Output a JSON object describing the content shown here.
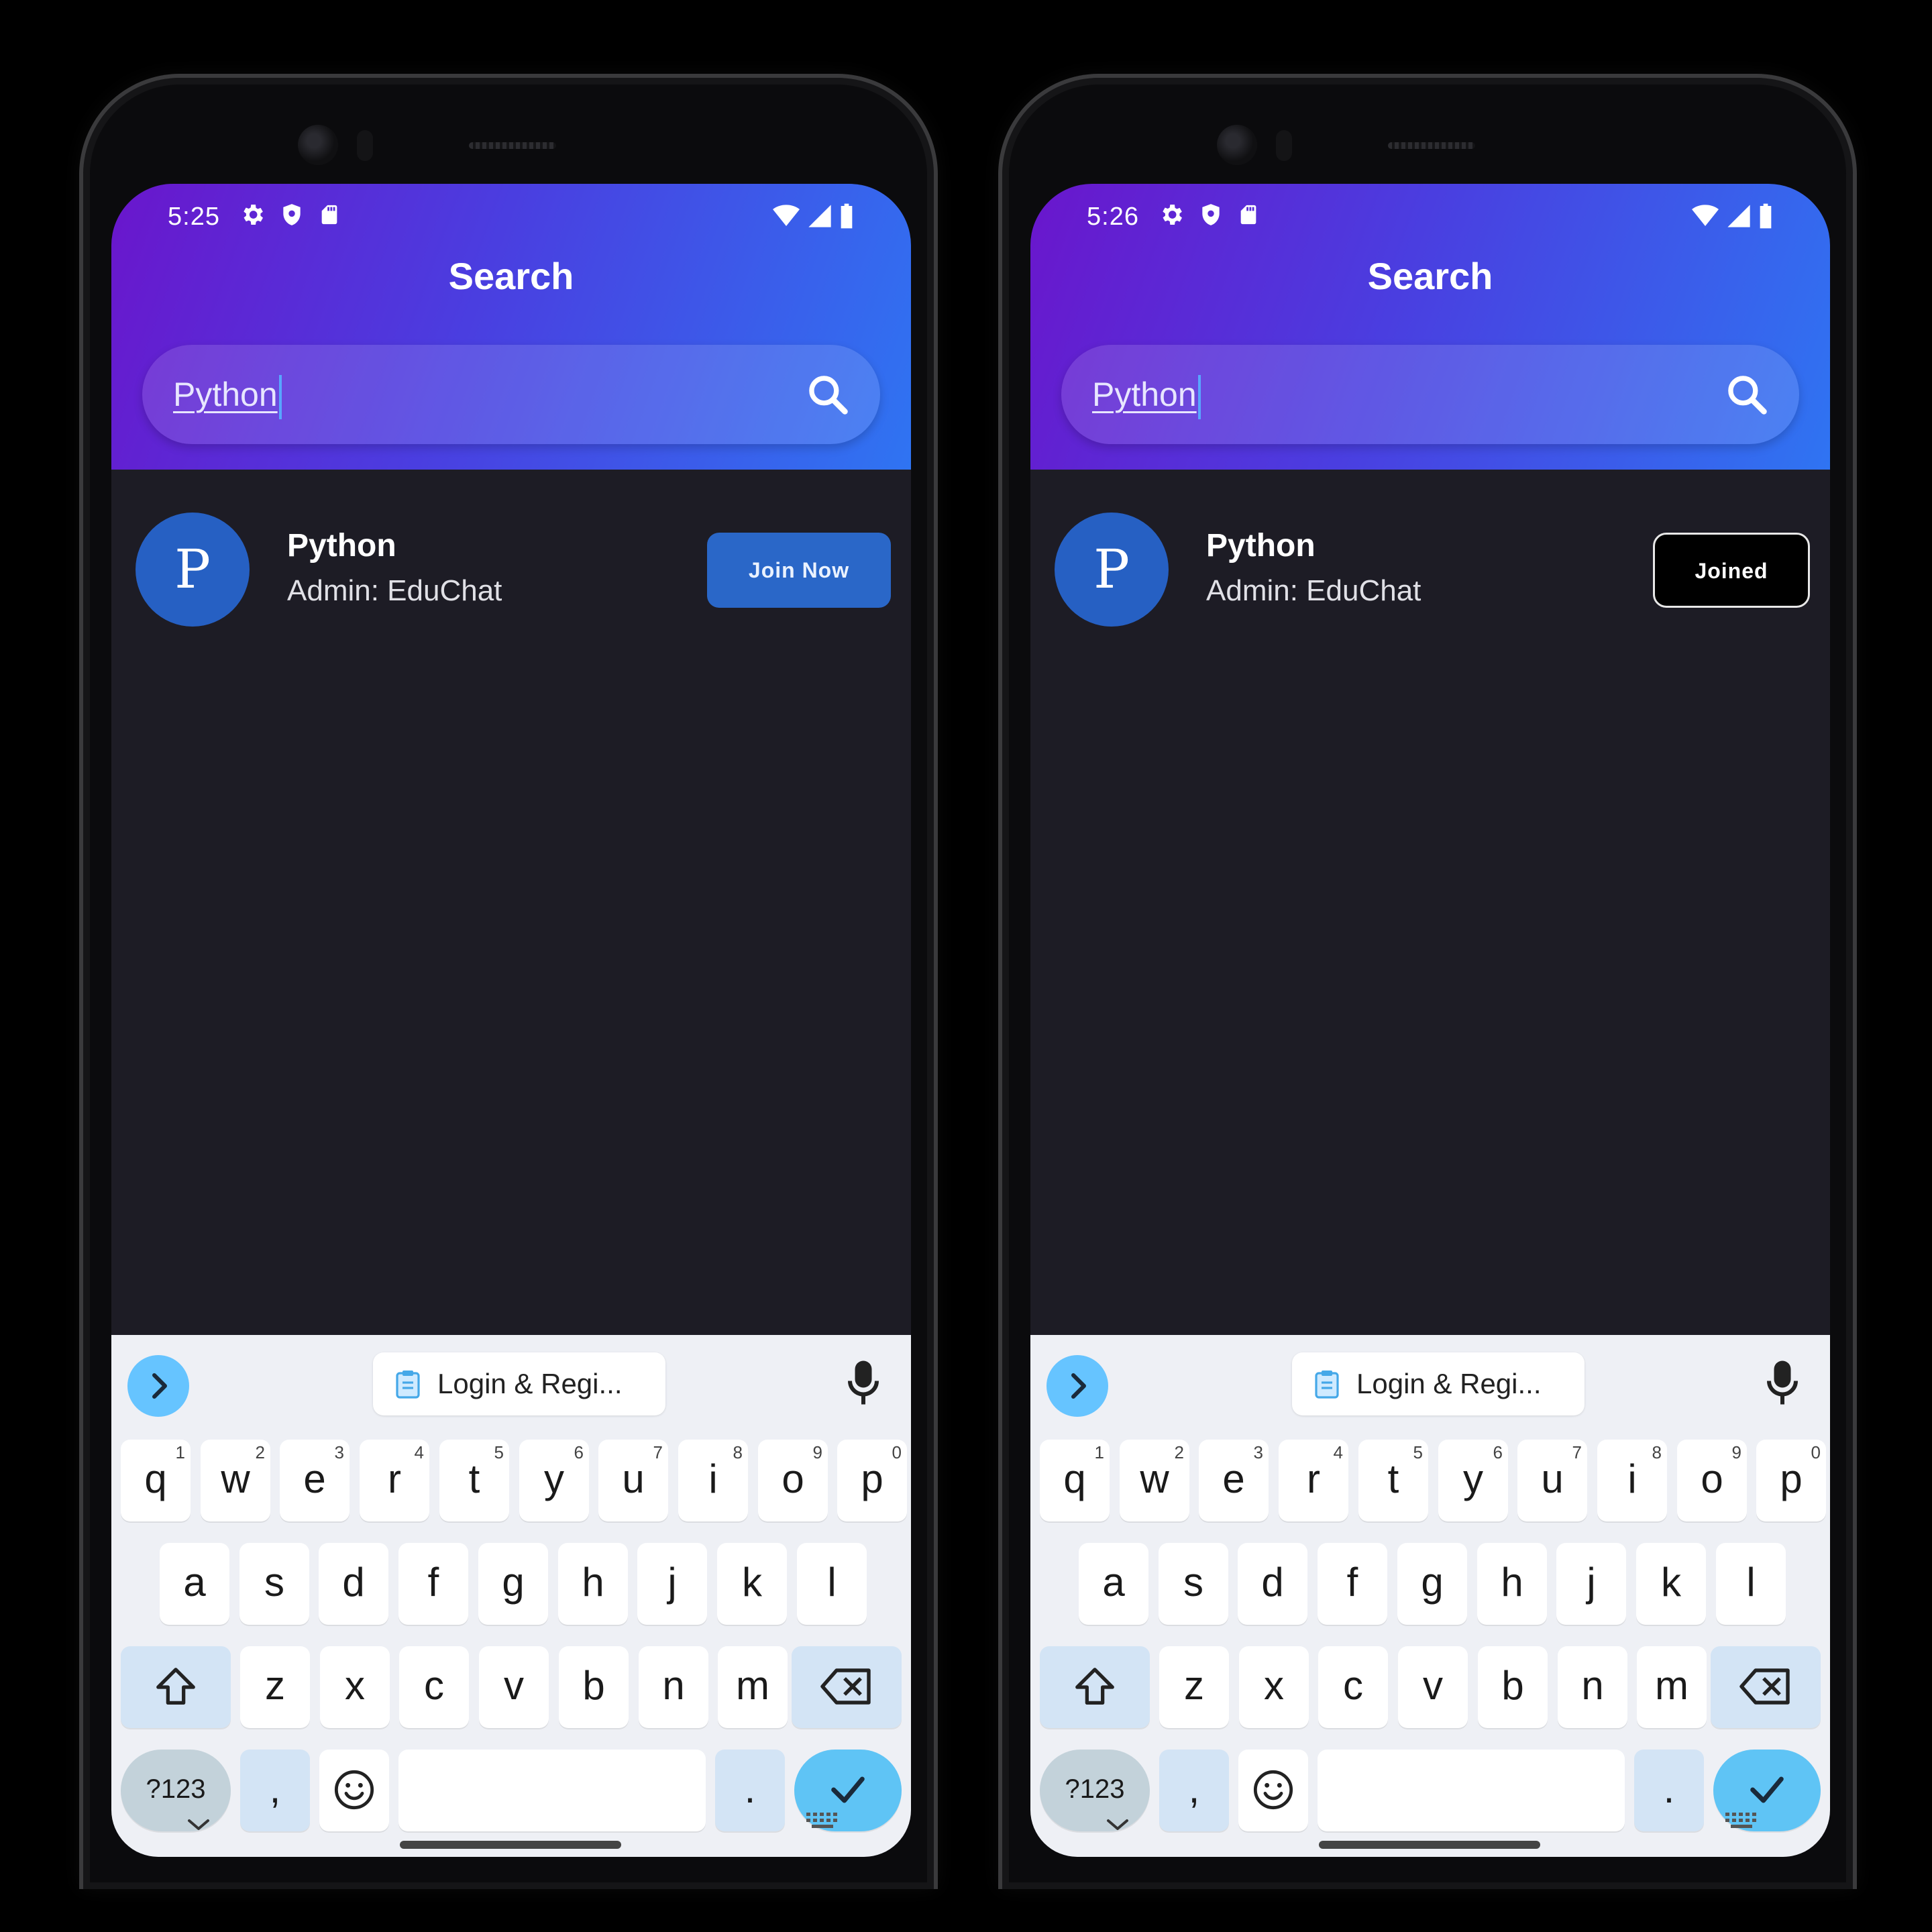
{
  "screens": [
    {
      "status": {
        "time": "5:25"
      },
      "header": {
        "title": "Search"
      },
      "search": {
        "value": "Python"
      },
      "result": {
        "avatar_letter": "P",
        "name": "Python",
        "admin": "Admin: EduChat",
        "action_label": "Join Now",
        "action_state": "not-joined"
      }
    },
    {
      "status": {
        "time": "5:26"
      },
      "header": {
        "title": "Search"
      },
      "search": {
        "value": "Python"
      },
      "result": {
        "avatar_letter": "P",
        "name": "Python",
        "admin": "Admin: EduChat",
        "action_label": "Joined",
        "action_state": "joined"
      }
    }
  ],
  "keyboard": {
    "suggestion": "Login & Regi...",
    "row1": [
      {
        "key": "q",
        "hint": "1"
      },
      {
        "key": "w",
        "hint": "2"
      },
      {
        "key": "e",
        "hint": "3"
      },
      {
        "key": "r",
        "hint": "4"
      },
      {
        "key": "t",
        "hint": "5"
      },
      {
        "key": "y",
        "hint": "6"
      },
      {
        "key": "u",
        "hint": "7"
      },
      {
        "key": "i",
        "hint": "8"
      },
      {
        "key": "o",
        "hint": "9"
      },
      {
        "key": "p",
        "hint": "0"
      }
    ],
    "row2": [
      "a",
      "s",
      "d",
      "f",
      "g",
      "h",
      "j",
      "k",
      "l"
    ],
    "row3": [
      "z",
      "x",
      "c",
      "v",
      "b",
      "n",
      "m"
    ],
    "symbols_label": "?123",
    "comma": ",",
    "period": "."
  },
  "colors": {
    "header_gradient_start": "#6a16cc",
    "header_gradient_end": "#2f74f2",
    "background": "#1d1c25",
    "avatar": "#2660c3",
    "join_button": "#2a67c8",
    "joined_button": "#000000",
    "keyboard_bg": "#eef0f5",
    "enter_key": "#5fc4f5"
  },
  "icons": {
    "status_left": [
      "gear-icon",
      "shield-icon",
      "sd-card-icon"
    ],
    "status_right": [
      "wifi-icon",
      "signal-icon",
      "battery-icon"
    ],
    "search": "search-icon",
    "keyboard": [
      "chevron-right-icon",
      "clipboard-icon",
      "mic-icon",
      "shift-icon",
      "backspace-icon",
      "emoji-icon",
      "check-icon",
      "chevron-down-icon",
      "keyboard-icon"
    ]
  }
}
